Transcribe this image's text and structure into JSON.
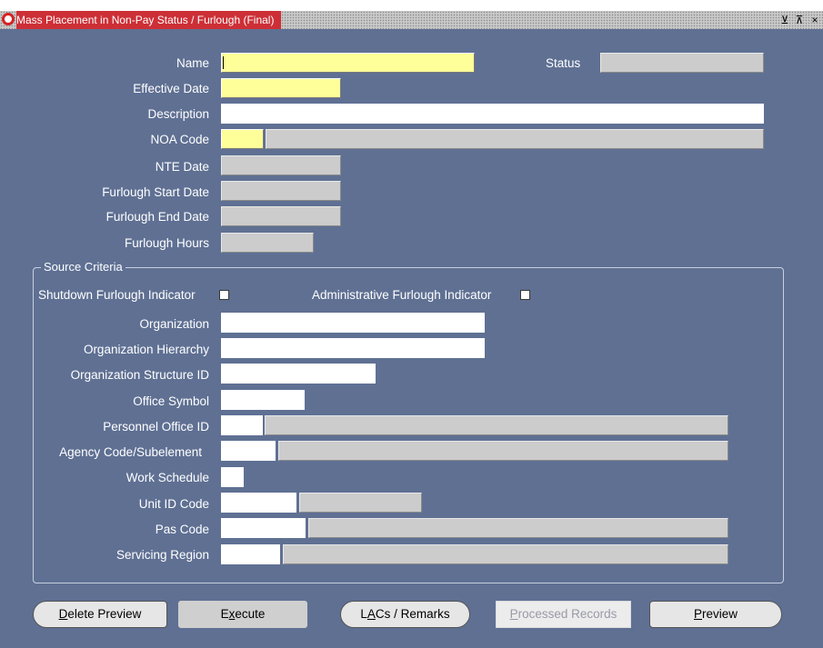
{
  "window": {
    "title": "Mass Placement in Non-Pay Status / Furlough (Final)",
    "controls": [
      "⊻",
      "⊼",
      "×"
    ]
  },
  "header_fields": {
    "name": {
      "label": "Name",
      "value": ""
    },
    "status": {
      "label": "Status",
      "value": ""
    },
    "effective_date": {
      "label": "Effective Date",
      "value": ""
    },
    "description": {
      "label": "Description",
      "value": ""
    },
    "noa_code": {
      "label": "NOA Code",
      "value": "",
      "desc": ""
    },
    "nte_date": {
      "label": "NTE Date",
      "value": ""
    },
    "furlough_start_date": {
      "label": "Furlough Start Date",
      "value": ""
    },
    "furlough_end_date": {
      "label": "Furlough End Date",
      "value": ""
    },
    "furlough_hours": {
      "label": "Furlough Hours",
      "value": ""
    }
  },
  "source_criteria": {
    "title": "Source Criteria",
    "shutdown_furlough_indicator": {
      "label": "Shutdown Furlough Indicator",
      "checked": false
    },
    "administrative_furlough_indicator": {
      "label": "Administrative Furlough Indicator",
      "checked": false
    },
    "organization": {
      "label": "Organization",
      "value": ""
    },
    "organization_hierarchy": {
      "label": "Organization Hierarchy",
      "value": ""
    },
    "organization_structure_id": {
      "label": "Organization Structure ID",
      "value": ""
    },
    "office_symbol": {
      "label": "Office Symbol",
      "value": ""
    },
    "personnel_office_id": {
      "label": "Personnel Office ID",
      "value": "",
      "desc": ""
    },
    "agency_code_subelement": {
      "label": "Agency Code/Subelement",
      "value": "",
      "desc": ""
    },
    "work_schedule": {
      "label": "Work Schedule",
      "value": ""
    },
    "unit_id_code": {
      "label": "Unit ID Code",
      "value": "",
      "desc": ""
    },
    "pas_code": {
      "label": "Pas Code",
      "value": "",
      "desc": ""
    },
    "servicing_region": {
      "label": "Servicing Region",
      "value": "",
      "desc": ""
    }
  },
  "buttons": {
    "delete_preview": {
      "mnemonic": "D",
      "rest": "elete Preview"
    },
    "execute": {
      "pre": "E",
      "mnemonic": "x",
      "rest": "ecute"
    },
    "lacs_remarks": {
      "pre": "L",
      "mnemonic": "A",
      "rest": "Cs / Remarks"
    },
    "processed_records": {
      "mnemonic": "P",
      "rest": "rocessed Records"
    },
    "preview": {
      "mnemonic": "P",
      "rest": "review"
    }
  },
  "colors": {
    "background": "#5f7093",
    "required_field": "#ffff99",
    "readonly_field": "#cccccc",
    "title_accent": "#cd2f36"
  }
}
